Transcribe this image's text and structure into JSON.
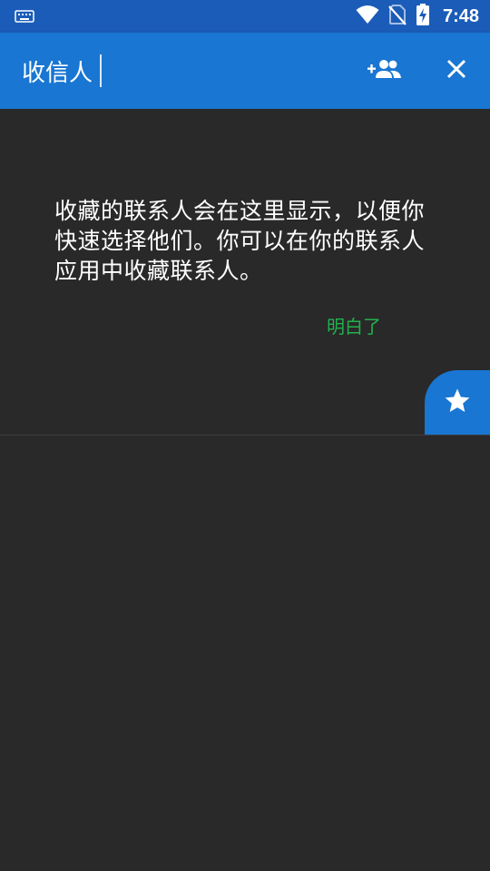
{
  "status_bar": {
    "time": "7:48",
    "left_icon": "keyboard-icon",
    "right_icons": [
      "wifi-icon",
      "no-sim-icon",
      "battery-charging-icon"
    ]
  },
  "app_bar": {
    "input_value": "收信人",
    "add_contact_icon": "add-person-icon",
    "close_icon": "close-icon",
    "color": "#1976d2"
  },
  "empty_state": {
    "message": "收藏的联系人会在这里显示，以便你快速选择他们。你可以在你的联系人应用中收藏联系人。",
    "dismiss_label": "明白了",
    "dismiss_color": "#22b14c"
  },
  "favorites_tab": {
    "icon": "star-icon"
  }
}
